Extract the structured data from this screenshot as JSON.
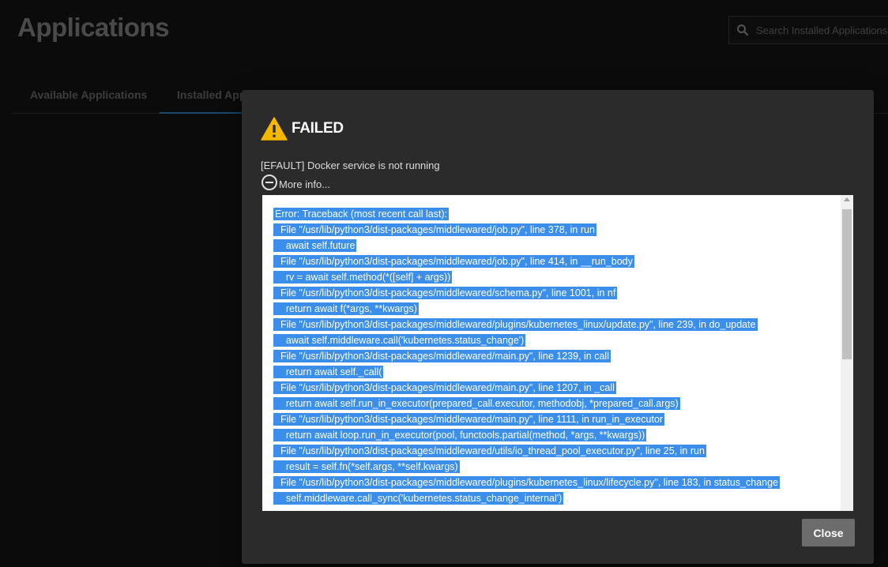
{
  "page": {
    "title": "Applications",
    "search": {
      "placeholder": "Search Installed Applications",
      "icon": "search-icon"
    }
  },
  "tabs": [
    {
      "label": "Available Applications"
    },
    {
      "label": "Installed Appl"
    }
  ],
  "dialog": {
    "title": "FAILED",
    "icon": "warning-icon",
    "message": "[EFAULT] Docker service is not running",
    "more_info_label": "More info...",
    "close_label": "Close",
    "traceback": [
      "Error: Traceback (most recent call last):",
      "  File \"/usr/lib/python3/dist-packages/middlewared/job.py\", line 378, in run",
      "    await self.future",
      "  File \"/usr/lib/python3/dist-packages/middlewared/job.py\", line 414, in __run_body",
      "    rv = await self.method(*([self] + args))",
      "  File \"/usr/lib/python3/dist-packages/middlewared/schema.py\", line 1001, in nf",
      "    return await f(*args, **kwargs)",
      "  File \"/usr/lib/python3/dist-packages/middlewared/plugins/kubernetes_linux/update.py\", line 239, in do_update",
      "    await self.middleware.call('kubernetes.status_change')",
      "  File \"/usr/lib/python3/dist-packages/middlewared/main.py\", line 1239, in call",
      "    return await self._call(",
      "  File \"/usr/lib/python3/dist-packages/middlewared/main.py\", line 1207, in _call",
      "    return await self.run_in_executor(prepared_call.executor, methodobj, *prepared_call.args)",
      "  File \"/usr/lib/python3/dist-packages/middlewared/main.py\", line 1111, in run_in_executor",
      "    return await loop.run_in_executor(pool, functools.partial(method, *args, **kwargs))",
      "  File \"/usr/lib/python3/dist-packages/middlewared/utils/io_thread_pool_executor.py\", line 25, in run",
      "    result = self.fn(*self.args, **self.kwargs)",
      "  File \"/usr/lib/python3/dist-packages/middlewared/plugins/kubernetes_linux/lifecycle.py\", line 183, in status_change",
      "    self.middleware.call_sync('kubernetes.status_change_internal')"
    ]
  },
  "colors": {
    "selection": "#3b8eea",
    "warning": "#f5b800",
    "dialog_bg": "#2b2b2b",
    "close_button": "#6c6c6c"
  }
}
